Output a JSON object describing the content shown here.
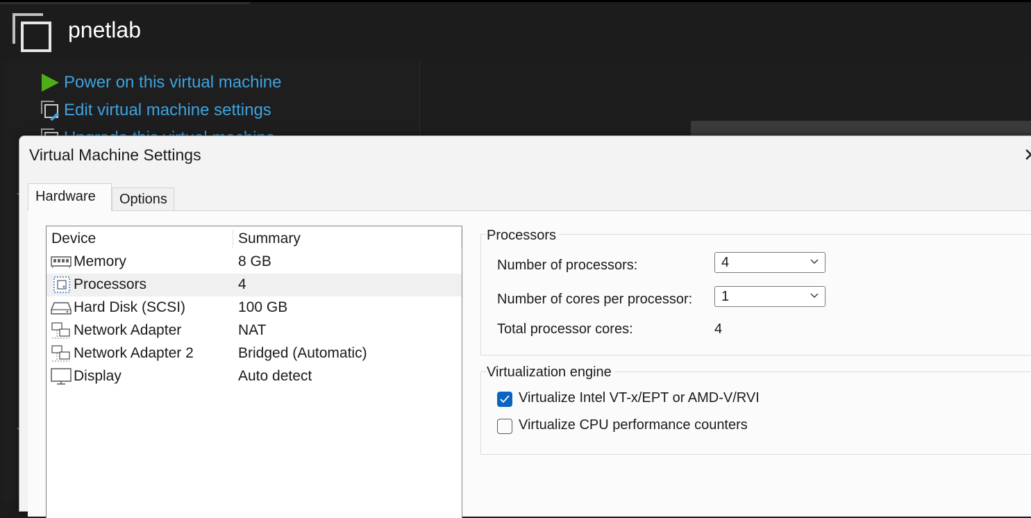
{
  "app": {
    "vm_name": "pnetlab",
    "commands": [
      {
        "label": "Power on this virtual machine",
        "icon": "play-icon"
      },
      {
        "label": "Edit virtual machine settings",
        "icon": "edit-settings-icon"
      },
      {
        "label": "Upgrade this virtual machine",
        "icon": "upgrade-icon"
      }
    ]
  },
  "dialog": {
    "title": "Virtual Machine Settings",
    "close_glyph": "✕",
    "tabs": [
      {
        "label": "Hardware",
        "active": true
      },
      {
        "label": "Options",
        "active": false
      }
    ],
    "device_list": {
      "columns": [
        "Device",
        "Summary"
      ],
      "rows": [
        {
          "device": "Memory",
          "summary": "8 GB",
          "icon": "memory-icon"
        },
        {
          "device": "Processors",
          "summary": "4",
          "icon": "processor-icon",
          "selected": true
        },
        {
          "device": "Hard Disk (SCSI)",
          "summary": "100 GB",
          "icon": "hard-disk-icon"
        },
        {
          "device": "Network Adapter",
          "summary": "NAT",
          "icon": "network-adapter-icon"
        },
        {
          "device": "Network Adapter 2",
          "summary": "Bridged (Automatic)",
          "icon": "network-adapter-icon"
        },
        {
          "device": "Display",
          "summary": "Auto detect",
          "icon": "display-icon"
        }
      ]
    },
    "processors": {
      "group_label": "Processors",
      "num_processors_label": "Number of processors:",
      "num_processors_value": "4",
      "cores_label": "Number of cores per processor:",
      "cores_value": "1",
      "total_label": "Total processor cores:",
      "total_value": "4"
    },
    "virtualization": {
      "group_label": "Virtualization engine",
      "options": [
        {
          "label": "Virtualize Intel VT-x/EPT or AMD-V/RVI",
          "checked": true
        },
        {
          "label": "Virtualize CPU performance counters",
          "checked": false
        }
      ]
    }
  },
  "colors": {
    "link_blue": "#3ea3e0",
    "play_green": "#4caf1a",
    "checkbox_blue": "#0a64c0",
    "dark_bg": "#1c1c1c"
  }
}
